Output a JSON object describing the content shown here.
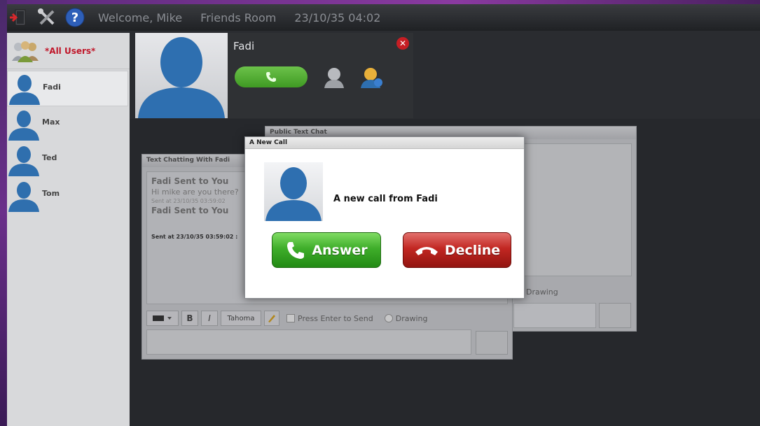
{
  "topbar": {
    "welcome": "Welcome, Mike",
    "room": "Friends Room",
    "datetime": "23/10/35 04:02",
    "icons": [
      "exit-icon",
      "tools-icon",
      "help-icon"
    ]
  },
  "sidebar": {
    "all_users_label": "*All Users*",
    "users": [
      {
        "name": "Fadi",
        "selected": true
      },
      {
        "name": "Max",
        "selected": false
      },
      {
        "name": "Ted",
        "selected": false
      },
      {
        "name": "Tom",
        "selected": false
      }
    ]
  },
  "profile": {
    "name": "Fadi"
  },
  "public_chat": {
    "title": "Public Text Chat",
    "input_label": "Drawing"
  },
  "private_chat": {
    "title": "Text Chatting With Fadi",
    "messages": [
      {
        "header": "Fadi Sent to You",
        "body": "Hi mike are you there?",
        "time": "Sent at 23/10/35 03:59:02"
      },
      {
        "header": "Fadi Sent to You",
        "body": "",
        "time": "Sent at 23/10/35 03:59:02 :"
      }
    ],
    "toolbar": {
      "bold": "B",
      "italic": "I",
      "font": "Tahoma",
      "press_enter_label": "Press Enter to Send",
      "drawing_label": "Drawing"
    }
  },
  "modal": {
    "title": "A New Call",
    "message": "A new call from Fadi",
    "answer_label": "Answer",
    "decline_label": "Decline"
  },
  "colors": {
    "answer": "#3fae2a",
    "decline": "#c22722",
    "all_users": "#c0172a",
    "frame": "#6a2f8a"
  }
}
